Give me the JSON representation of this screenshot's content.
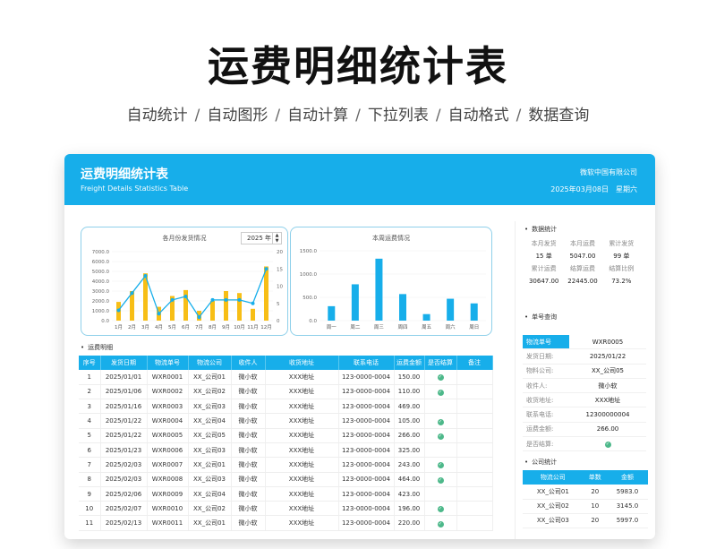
{
  "page": {
    "title": "运费明细统计表",
    "features": [
      "自动统计",
      "自动图形",
      "自动计算",
      "下拉列表",
      "自动格式",
      "数据查询"
    ]
  },
  "header": {
    "title": "运费明细统计表",
    "subtitle": "Freight Details Statistics Table",
    "company": "微软中国有限公司",
    "date": "2025年03月08日",
    "weekday": "星期六"
  },
  "monthly_chart": {
    "title": "各月份发货情况",
    "year": "2025 年"
  },
  "weekly_chart": {
    "title": "本周运费情况"
  },
  "chart_data": [
    {
      "type": "bar",
      "title": "各月份发货情况",
      "categories": [
        "1月",
        "2月",
        "3月",
        "4月",
        "5月",
        "6月",
        "7月",
        "8月",
        "9月",
        "10月",
        "11月",
        "12月"
      ],
      "series": [
        {
          "values": [
            1900,
            3000,
            4800,
            1400,
            2500,
            3100,
            1000,
            2000,
            3000,
            2800,
            1200,
            5500
          ]
        },
        {
          "values": [
            3,
            8,
            13,
            2,
            6,
            7,
            1,
            6,
            6,
            6,
            5,
            15
          ]
        }
      ],
      "y_ticks": [
        "7000.0",
        "6000.0",
        "5000.0",
        "4000.0",
        "3000.0",
        "2000.0",
        "1000.0",
        "0.0"
      ],
      "y2_ticks": [
        "20",
        "15",
        "10",
        "5",
        "0"
      ],
      "ylim": [
        0,
        7000
      ],
      "y2lim": [
        0,
        20
      ],
      "colors": {
        "bar": "#f7be16",
        "line": "#17aeea"
      }
    },
    {
      "type": "bar",
      "title": "本周运费情况",
      "categories": [
        "周一",
        "周二",
        "周三",
        "周四",
        "周五",
        "周六",
        "周日"
      ],
      "values": [
        310,
        780,
        1330,
        570,
        140,
        470,
        370
      ],
      "y_ticks": [
        "1500.0",
        "1000.0",
        "500.0",
        "0.0"
      ],
      "ylim": [
        0,
        1500
      ],
      "colors": {
        "bar": "#17aeea"
      }
    }
  ],
  "detail": {
    "label": "运费明细",
    "columns": [
      "序号",
      "发货日期",
      "物流单号",
      "物流公司",
      "收件人",
      "收货地址",
      "联系电话",
      "运费金额",
      "是否结算",
      "备注"
    ],
    "rows": [
      [
        "1",
        "2025/01/01",
        "WXR0001",
        "XX_公司01",
        "微小软",
        "XXX地址",
        "123-0000-0004",
        "150.00",
        true
      ],
      [
        "2",
        "2025/01/06",
        "WXR0002",
        "XX_公司02",
        "微小软",
        "XXX地址",
        "123-0000-0004",
        "110.00",
        true
      ],
      [
        "3",
        "2025/01/16",
        "WXR0003",
        "XX_公司03",
        "微小软",
        "XXX地址",
        "123-0000-0004",
        "469.00",
        false
      ],
      [
        "4",
        "2025/01/22",
        "WXR0004",
        "XX_公司04",
        "微小软",
        "XXX地址",
        "123-0000-0004",
        "105.00",
        true
      ],
      [
        "5",
        "2025/01/22",
        "WXR0005",
        "XX_公司05",
        "微小软",
        "XXX地址",
        "123-0000-0004",
        "266.00",
        true
      ],
      [
        "6",
        "2025/01/23",
        "WXR0006",
        "XX_公司03",
        "微小软",
        "XXX地址",
        "123-0000-0004",
        "325.00",
        false
      ],
      [
        "7",
        "2025/02/03",
        "WXR0007",
        "XX_公司01",
        "微小软",
        "XXX地址",
        "123-0000-0004",
        "243.00",
        true
      ],
      [
        "8",
        "2025/02/03",
        "WXR0008",
        "XX_公司03",
        "微小软",
        "XXX地址",
        "123-0000-0004",
        "464.00",
        true
      ],
      [
        "9",
        "2025/02/06",
        "WXR0009",
        "XX_公司04",
        "微小软",
        "XXX地址",
        "123-0000-0004",
        "423.00",
        false
      ],
      [
        "10",
        "2025/02/07",
        "WXR0010",
        "XX_公司02",
        "微小软",
        "XXX地址",
        "123-0000-0004",
        "196.00",
        true
      ],
      [
        "11",
        "2025/02/13",
        "WXR0011",
        "XX_公司01",
        "微小软",
        "XXX地址",
        "123-0000-0004",
        "220.00",
        true
      ]
    ]
  },
  "stats": {
    "label": "数据统计",
    "row1_labels": [
      "本月发货",
      "本月运费",
      "累计发货"
    ],
    "row1_values": [
      "15 单",
      "5047.00",
      "99 单"
    ],
    "row2_labels": [
      "累计运费",
      "结算运费",
      "结算比例"
    ],
    "row2_values": [
      "30647.00",
      "22445.00",
      "73.2%"
    ]
  },
  "query": {
    "label": "单号查询",
    "rows": [
      {
        "k": "物流单号",
        "v": "WXR0005"
      },
      {
        "k": "发货日期:",
        "v": "2025/01/22"
      },
      {
        "k": "物料公司:",
        "v": "XX_公司05"
      },
      {
        "k": "收件人:",
        "v": "微小软"
      },
      {
        "k": "收货地址:",
        "v": "XXX地址"
      },
      {
        "k": "联系电话:",
        "v": "12300000004"
      },
      {
        "k": "运费金额:",
        "v": "266.00"
      },
      {
        "k": "是否结算:",
        "v": ""
      }
    ]
  },
  "company_stats": {
    "label": "公司统计",
    "columns": [
      "物流公司",
      "单数",
      "金额"
    ],
    "rows": [
      [
        "XX_公司01",
        "20",
        "5983.0"
      ],
      [
        "XX_公司02",
        "10",
        "3145.0"
      ],
      [
        "XX_公司03",
        "20",
        "5997.0"
      ]
    ]
  }
}
